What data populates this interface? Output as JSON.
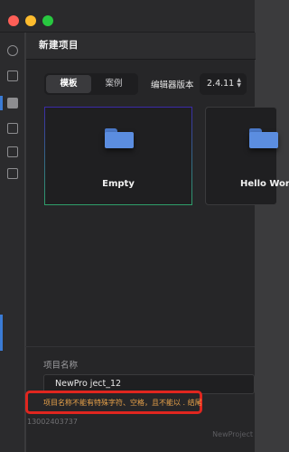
{
  "dialog": {
    "title": "新建项目",
    "tabs": [
      {
        "label": "模板",
        "active": true
      },
      {
        "label": "案例",
        "active": false
      }
    ],
    "version_label": "编辑器版本",
    "version_value": "2.4.11",
    "version_arrows": "▲▼",
    "templates": [
      {
        "label": "Empty",
        "icon": "folder-icon",
        "selected": true
      },
      {
        "label": "Hello World",
        "icon": "folder-icon",
        "selected": false
      }
    ],
    "project_name_label": "项目名称",
    "project_name_value": "NewPro ject_12",
    "error_message": "项目名称不能有特殊字符、空格，且不能以 . 结尾"
  },
  "background": {
    "bottom_text": "13002403737",
    "bottom_right_text": "NewProject"
  },
  "colors": {
    "error_border": "#e0261f",
    "error_text": "#e8a24a",
    "folder_blue": "#5b8de0",
    "selected_card_border_top": "#3b2aa8",
    "selected_card_border_bottom": "#2f9f6b"
  }
}
